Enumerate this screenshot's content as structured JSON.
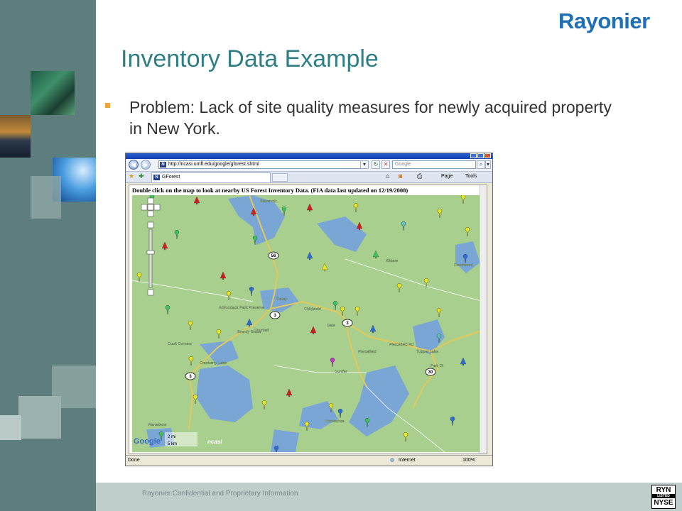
{
  "logo_text": "Rayonier",
  "slide_title": "Inventory Data Example",
  "bullet_text": "Problem: Lack of site quality measures for newly acquired property in New York.",
  "footer_text": "Rayonier Confidential and Proprietary Information",
  "exchange_badge": {
    "line1": "RYN",
    "line2": "LISTED",
    "line3": "NYSE"
  },
  "browser": {
    "address_url": "http://ncasi.umfl.edu/google/gforest.shtml",
    "search_placeholder": "Google",
    "tab_title": "GForest",
    "commands": [
      "Page",
      "Tools"
    ],
    "instruction": "Double click on the map to look at nearby US Forest Inventory Data. (FIA data last updated on 12/19/2008)",
    "status_left": "Done",
    "status_zone": "Internet",
    "zoom": "100%"
  },
  "map": {
    "place_labels": [
      "Reservoir",
      "Adirondack Park Preserve",
      "Kildare",
      "Floodwood",
      "Sevey",
      "Childwold",
      "Gale",
      "Brandy Brook",
      "Shurtleff",
      "Cook Corners",
      "Cranberry Lake",
      "Piercefield",
      "Piercefield Rd",
      "Tupper Lake",
      "Conifer",
      "Wanakena",
      "Horseshoe",
      "Park St"
    ],
    "route_shields": [
      "56",
      "3",
      "3",
      "3",
      "30"
    ],
    "scale_mi": "2 mi",
    "scale_km": "5 km",
    "branding": "ncasi",
    "google_label": "Google"
  },
  "colors": {
    "title": "#2e7f85",
    "bullet": "#f0a33b",
    "band": "#5d7e7d",
    "footer_band": "#bfcdcb",
    "map_land": "#a8cf8e",
    "map_water": "#7aa6d6"
  }
}
